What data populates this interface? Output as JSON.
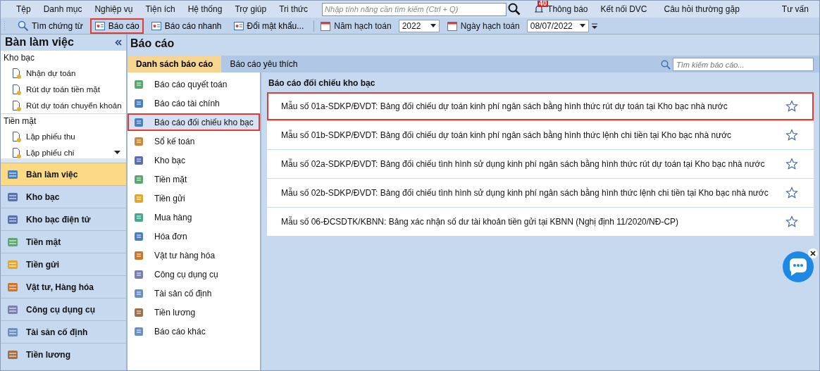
{
  "menu": {
    "items": [
      "Tệp",
      "Danh mục",
      "Nghiệp vụ",
      "Tiện ích",
      "Hệ thống",
      "Trợ giúp",
      "Tri thức"
    ],
    "search": {
      "placeholder": "Nhập tính năng cần tìm kiếm (Ctrl + Q)"
    },
    "notifications": {
      "badge": "40",
      "label": "Thông báo"
    },
    "connect": "Kết nối DVC",
    "faq": "Câu hỏi thường gặp",
    "support": "Tư vấn"
  },
  "toolbar": {
    "buttons": [
      {
        "label": "Tìm chứng từ",
        "highlighted": false
      },
      {
        "label": "Báo cáo",
        "highlighted": true
      },
      {
        "label": "Báo cáo nhanh",
        "highlighted": false
      },
      {
        "label": "Đổi mật khẩu...",
        "highlighted": false
      }
    ],
    "year_label": "Năm hạch toán",
    "year": "2022",
    "date_label": "Ngày hạch toán",
    "date": "08/07/2022"
  },
  "sidebar": {
    "title": "Bàn làm việc",
    "groups": [
      {
        "title": "Kho bạc",
        "items": [
          "Nhận dự toán",
          "Rút dự toán tiền mặt",
          "Rút dự toán chuyển khoản"
        ]
      },
      {
        "title": "Tiền mặt",
        "items": [
          "Lập phiếu thu",
          "Lập phiếu chi"
        ]
      }
    ],
    "nav": [
      {
        "label": "Bàn làm việc",
        "selected": true
      },
      {
        "label": "Kho bạc",
        "selected": false
      },
      {
        "label": "Kho bạc điện tử",
        "selected": false
      },
      {
        "label": "Tiền mặt",
        "selected": false
      },
      {
        "label": "Tiền gửi",
        "selected": false
      },
      {
        "label": "Vật tư, Hàng hóa",
        "selected": false
      },
      {
        "label": "Công cụ dụng cụ",
        "selected": false
      },
      {
        "label": "Tài sản cố định",
        "selected": false
      },
      {
        "label": "Tiền lương",
        "selected": false
      }
    ]
  },
  "page": {
    "title": "Báo cáo",
    "tabs": [
      {
        "label": "Danh sách báo cáo",
        "selected": true
      },
      {
        "label": "Báo cáo yêu thích",
        "selected": false
      }
    ],
    "search": {
      "placeholder": "Tìm kiếm báo cáo..."
    },
    "categories": [
      {
        "label": "Báo cáo quyết toán",
        "selected": false,
        "highlighted": false
      },
      {
        "label": "Báo cáo tài chính",
        "selected": false,
        "highlighted": false
      },
      {
        "label": "Báo cáo đối chiếu kho bạc",
        "selected": true,
        "highlighted": true
      },
      {
        "label": "Sổ kế toán",
        "selected": false,
        "highlighted": false
      },
      {
        "label": "Kho bạc",
        "selected": false,
        "highlighted": false
      },
      {
        "label": "Tiền mặt",
        "selected": false,
        "highlighted": false
      },
      {
        "label": "Tiền gửi",
        "selected": false,
        "highlighted": false
      },
      {
        "label": "Mua hàng",
        "selected": false,
        "highlighted": false
      },
      {
        "label": "Hóa đơn",
        "selected": false,
        "highlighted": false
      },
      {
        "label": "Vật tư hàng hóa",
        "selected": false,
        "highlighted": false
      },
      {
        "label": "Công cụ dụng cụ",
        "selected": false,
        "highlighted": false
      },
      {
        "label": "Tài sản cố định",
        "selected": false,
        "highlighted": false
      },
      {
        "label": "Tiền lương",
        "selected": false,
        "highlighted": false
      },
      {
        "label": "Báo cáo khác",
        "selected": false,
        "highlighted": false
      }
    ],
    "section_title": "Báo cáo đối chiếu kho bạc",
    "reports": [
      {
        "label": "Mẫu số 01a-SDKP/ĐVDT: Bảng đối chiếu dự toán kinh phí ngân sách bằng hình thức rút dự toán tại Kho bạc nhà nước",
        "highlighted": true
      },
      {
        "label": "Mẫu số 01b-SDKP/ĐVDT: Bảng đối chiếu dự toán kinh phí ngân sách bằng hình thức lệnh chi tiền tại Kho bạc nhà nước",
        "highlighted": false
      },
      {
        "label": "Mẫu số 02a-SDKP/ĐVDT: Bảng đối chiếu tình hình sử dụng kinh phí ngân sách bằng hình thức rút dự toán tại Kho bạc nhà nước",
        "highlighted": false
      },
      {
        "label": "Mẫu số 02b-SDKP/ĐVDT: Bảng đối chiếu tình hình sử dụng kinh phí ngân sách bằng hình thức lệnh chi tiền tại Kho bạc nhà nước",
        "highlighted": false
      },
      {
        "label": "Mẫu số 06-ĐCSDTK/KBNN: Bảng xác nhận số dư tài khoản tiền gửi tại KBNN (Nghị định 11/2020/NĐ-CP)",
        "highlighted": false
      }
    ]
  }
}
